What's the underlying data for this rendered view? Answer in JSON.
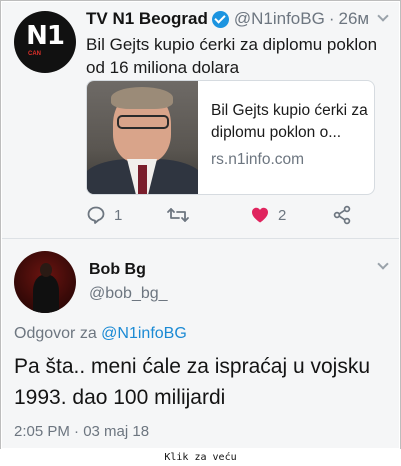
{
  "tweet": {
    "author_name": "TV N1 Beograd",
    "handle": "@N1infoBG",
    "separator": "·",
    "time": "26м",
    "avatar_mark": "N1",
    "avatar_badge": "CAN",
    "text": "Bil Gejts kupio ćerki za diplomu poklon od 16 miliona dolara",
    "link_card": {
      "title": "Bil Gejts kupio ćerki za diplomu poklon o...",
      "domain": "rs.n1info.com"
    },
    "actions": {
      "reply_count": "1",
      "retweet_count": "",
      "like_count": "2"
    }
  },
  "reply": {
    "author_name": "Bob Bg",
    "handle": "@bob_bg_",
    "reply_prefix": "Odgovor za",
    "reply_mention": "@N1infoBG",
    "text": "Pa šta.. meni ćale za ispraćaj u vojsku 1993. dao 100 milijardi",
    "timestamp": "2:05 PM · 03 maj 18"
  },
  "footer": {
    "caption": "Klik za veću"
  },
  "colors": {
    "verified": "#1c94e0",
    "like_heart": "#e0245e",
    "mention": "#1b8ad4",
    "secondary_text": "#6d7680"
  },
  "icons": [
    "verified-badge-icon",
    "chevron-down-icon",
    "reply-icon",
    "retweet-icon",
    "heart-icon",
    "share-icon"
  ]
}
